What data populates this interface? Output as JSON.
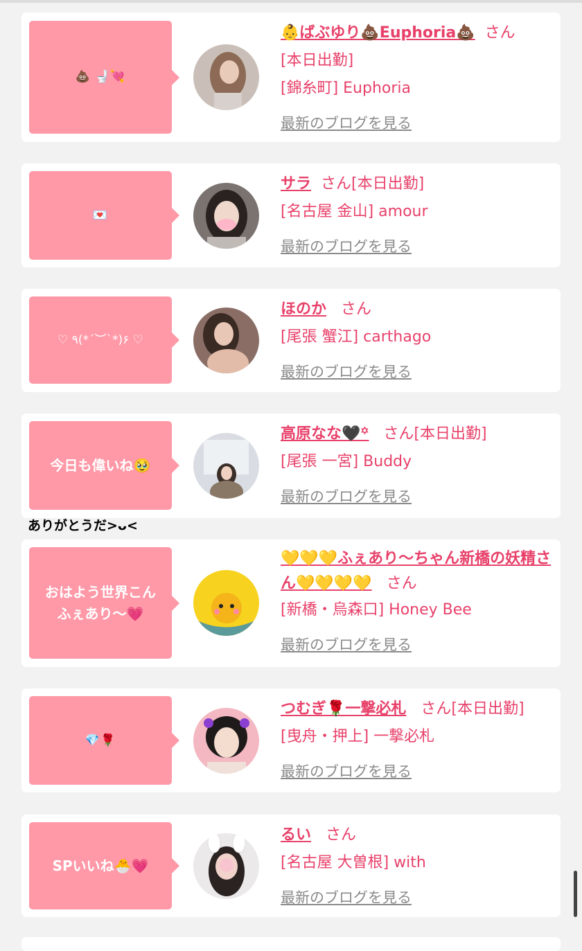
{
  "blog_link_label": "最新のブログを見る",
  "outside_text": "ありがとうだ>ᴗ<",
  "cards": [
    {
      "bubble": "💩 🚽💘",
      "name": "👶ばぶゆり💩Euphoria💩",
      "san": "さん",
      "status": "[本日出勤]",
      "shop": "[錦糸町] Euphoria"
    },
    {
      "bubble": "💌",
      "name": "サラ",
      "san": "さん[本日出勤]",
      "status": "",
      "shop": "[名古屋 金山] amour"
    },
    {
      "bubble": "♡ ٩(*´︶`*)۶ ♡",
      "name": "ほのか",
      "san": "さん",
      "status": "",
      "shop": "[尾張 蟹江] carthago"
    },
    {
      "bubble": "今日も偉いね🥹",
      "name": "高原なな🖤꙳",
      "san": "さん[本日出勤]",
      "status": "",
      "shop": "[尾張 一宮] Buddy"
    },
    {
      "bubble": "おはよう世界こん\nふぇあり〜💗",
      "name": "💛💛💛ふぇあり〜ちゃん新橋の妖精さん💛💛💛💛",
      "san": "さん",
      "status": "",
      "shop": "[新橋・烏森口] Honey Bee"
    },
    {
      "bubble": "💎🌹",
      "name": "つむぎ🌹一撃必札",
      "san": "さん[本日出勤]",
      "status": "",
      "shop": "[曳舟・押上] 一撃必札"
    },
    {
      "bubble": "SPいいね🐣💗",
      "name": "るい",
      "san": "さん",
      "status": "",
      "shop": "[名古屋 大曽根] with"
    }
  ]
}
